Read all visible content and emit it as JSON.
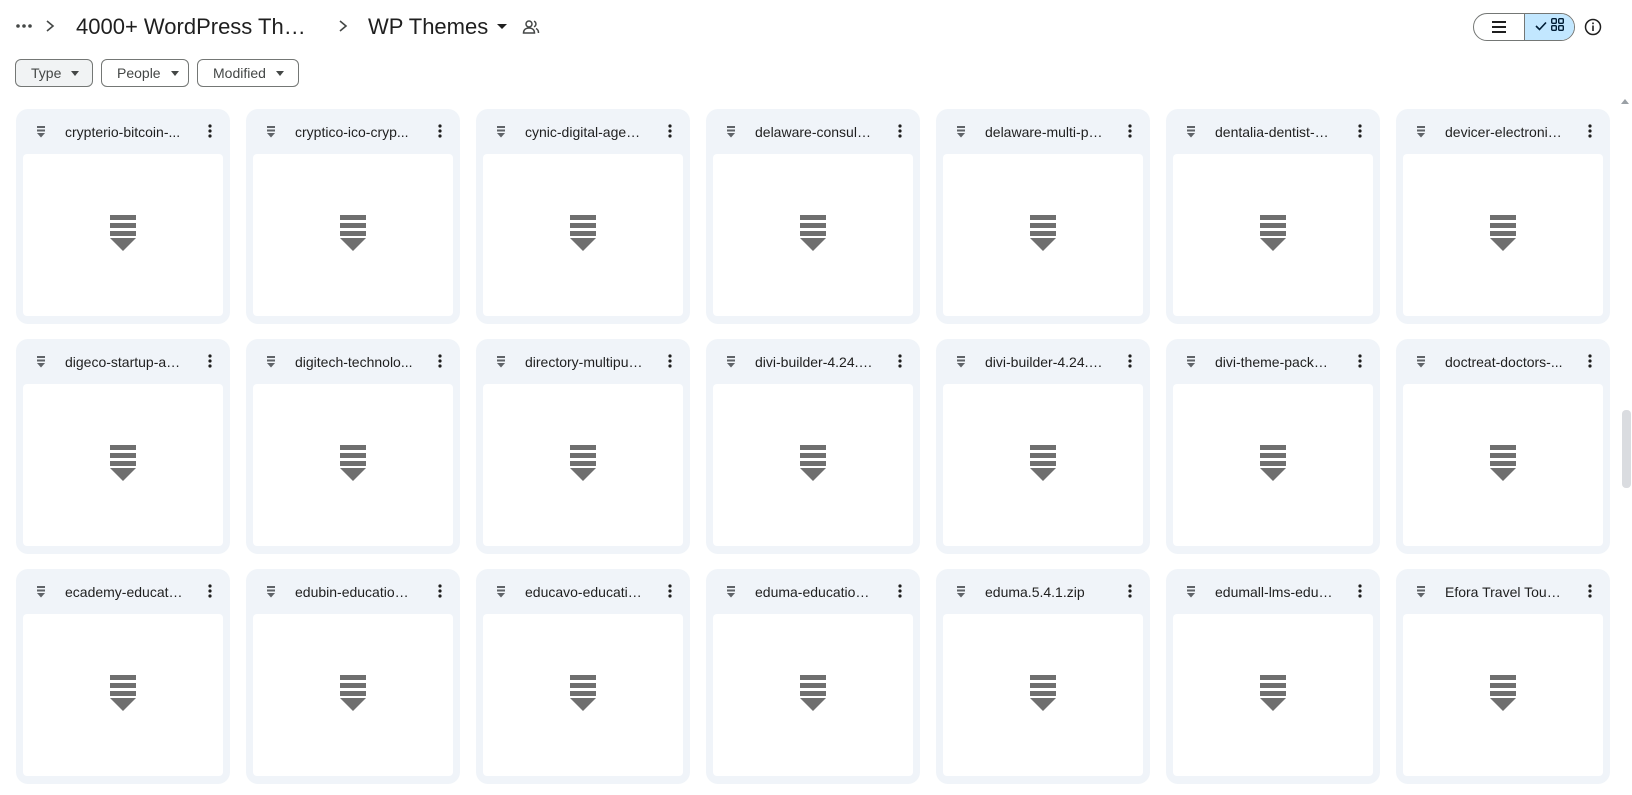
{
  "breadcrumb": {
    "more_icon": "more-horiz-icon",
    "parent": "4000+ WordPress The...",
    "current": "WP Themes",
    "shared_icon": "people-icon"
  },
  "view_toggle": {
    "list_icon": "list-view-icon",
    "grid_icon": "grid-view-icon",
    "selected": "grid"
  },
  "info_icon": "info-icon",
  "filters": [
    {
      "label": "Type"
    },
    {
      "label": "People"
    },
    {
      "label": "Modified"
    }
  ],
  "files": [
    {
      "name": "crypterio-bitcoin-..."
    },
    {
      "name": "cryptico-ico-cryp..."
    },
    {
      "name": "cynic-digital-agen..."
    },
    {
      "name": "delaware-consulti..."
    },
    {
      "name": "delaware-multi-pu..."
    },
    {
      "name": "dentalia-dentist-m..."
    },
    {
      "name": "devicer-electronic..."
    },
    {
      "name": "digeco-startup-ag..."
    },
    {
      "name": "digitech-technolo..."
    },
    {
      "name": "directory-multipur..."
    },
    {
      "name": "divi-builder-4.24.0..."
    },
    {
      "name": "divi-builder-4.24.2..."
    },
    {
      "name": "divi-theme-packa..."
    },
    {
      "name": "doctreat-doctors-..."
    },
    {
      "name": "ecademy-educati..."
    },
    {
      "name": "edubin-education-..."
    },
    {
      "name": "educavo-educatio..."
    },
    {
      "name": "eduma-education-..."
    },
    {
      "name": "eduma.5.4.1.zip"
    },
    {
      "name": "edumall-lms-educ..."
    },
    {
      "name": "Efora Travel Tour B..."
    }
  ],
  "colors": {
    "card_bg": "#f0f4f9",
    "selected_toggle": "#c2e7ff",
    "icon_gray": "#6f6f6f"
  }
}
